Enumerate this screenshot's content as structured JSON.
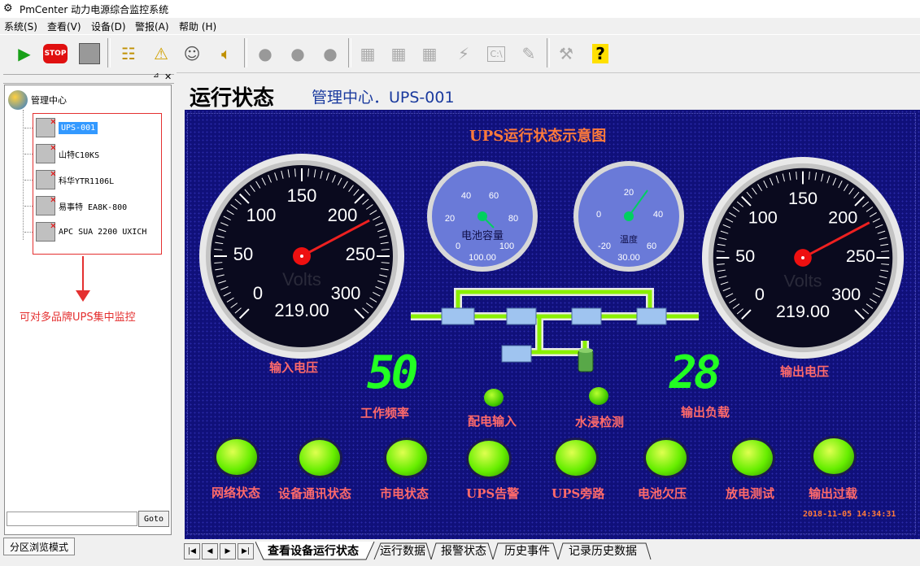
{
  "window": {
    "title": "PmCenter 动力电源综合监控系统"
  },
  "menu": [
    "系统(S)",
    "查看(V)",
    "设备(D)",
    "警报(A)",
    "帮助 (H)"
  ],
  "toolbar": {
    "stop_label": "STOP"
  },
  "tree": {
    "root": "管理中心",
    "items": [
      "UPS-001",
      "山特C10KS",
      "科华YTR1106L",
      "易事特 EA8K-800",
      "APC SUA 2200 UXICH"
    ],
    "annotation": "可对多品牌UPS集中监控",
    "goto_label": "Goto",
    "mode_button": "分区浏览模式"
  },
  "header": {
    "title": "运行状态",
    "path": "管理中心．UPS-001"
  },
  "diagram": {
    "title": "UPS运行状态示意图",
    "input_gauge": {
      "ticks": [
        "0",
        "50",
        "100",
        "150",
        "200",
        "250",
        "300"
      ],
      "unit": "Volts",
      "value": "219.00",
      "label": "输入电压",
      "reading": 219.0
    },
    "output_gauge": {
      "ticks": [
        "0",
        "50",
        "100",
        "150",
        "200",
        "250",
        "300"
      ],
      "unit": "Volts",
      "value": "219.00",
      "label": "输出电压",
      "reading": 219.0
    },
    "battery_gauge": {
      "ticks": [
        "20",
        "40",
        "60",
        "80",
        "100",
        "0"
      ],
      "caption": "电池容量",
      "value": "100.00",
      "reading": 100
    },
    "temp_gauge": {
      "ticks": [
        "20",
        "40",
        "60",
        "0",
        "-20"
      ],
      "caption": "温度",
      "value": "30.00",
      "reading": 30
    },
    "freq": {
      "value": "50",
      "label": "工作频率"
    },
    "load": {
      "value": "28",
      "label": "输出负载"
    },
    "small_indicators": [
      "配电输入",
      "水浸检测"
    ],
    "indicators": [
      "网络状态",
      "设备通讯状态",
      "市电状态",
      "UPS告警",
      "UPS旁路",
      "电池欠压",
      "放电测试",
      "输出过载"
    ],
    "timestamp": "2018-11-05 14:34:31"
  },
  "tabs": [
    "查看设备运行状态",
    "运行数据",
    "报警状态",
    "历史事件",
    "记录历史数据"
  ]
}
